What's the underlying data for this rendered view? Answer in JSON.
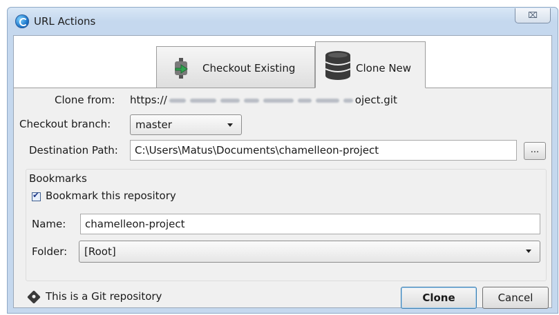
{
  "window": {
    "title": "URL Actions",
    "close_label": "⌧"
  },
  "tabs": [
    {
      "label": "Checkout Existing",
      "icon": "checkout-arrow-icon"
    },
    {
      "label": "Clone New",
      "icon": "database-icon"
    }
  ],
  "clone_from": {
    "label": "Clone from:",
    "prefix": "https://",
    "suffix": "oject.git"
  },
  "checkout_branch": {
    "label": "Checkout branch:",
    "value": "master"
  },
  "destination": {
    "label": "Destination Path:",
    "value": "C:\\Users\\Matus\\Documents\\chamelleon-project",
    "browse_label": "..."
  },
  "bookmarks": {
    "legend": "Bookmarks",
    "checkbox_label": "Bookmark this repository",
    "checked": true,
    "name_label": "Name:",
    "name_value": "chamelleon-project",
    "folder_label": "Folder:",
    "folder_value": "[Root]"
  },
  "footer": {
    "status_text": "This is a Git repository",
    "clone_button": "Clone",
    "cancel_button": "Cancel"
  }
}
